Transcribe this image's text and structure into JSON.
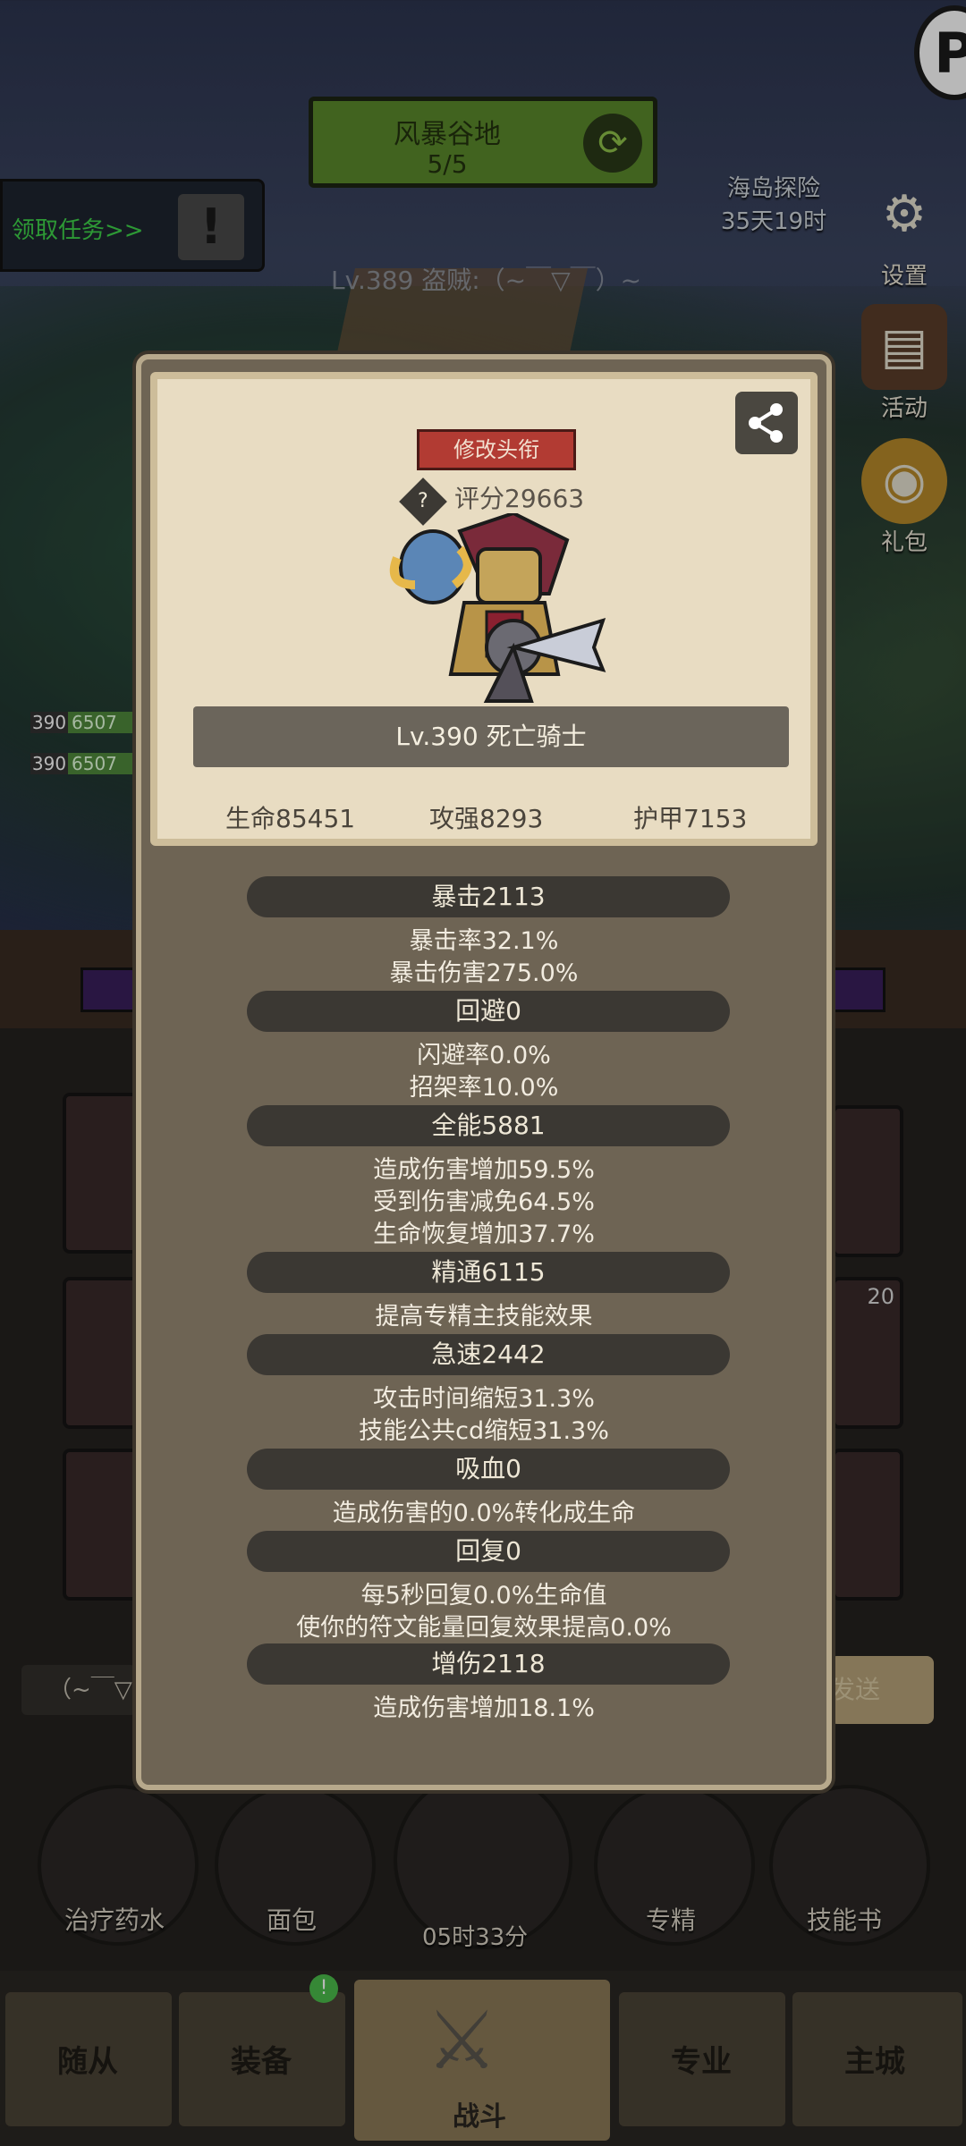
{
  "hud": {
    "zone_title": "风暴谷地",
    "zone_progress": "5/5",
    "task_label": "领取任务>>",
    "player_line": "Lv.389 盗贼:（~￣▽￣）~",
    "island": {
      "label": "海岛探险",
      "timer": "35天19时"
    },
    "settings_label": "设置",
    "activity_label": "活动",
    "gift_label": "礼包",
    "left_hp": [
      {
        "lv": "390",
        "value": "6507"
      },
      {
        "lv": "390",
        "value": "6507"
      }
    ]
  },
  "profile": {
    "rename_button": "修改头衔",
    "score": "评分29663",
    "level_name": "Lv.390 死亡骑士",
    "hp": "生命85451",
    "attack": "攻强8293",
    "armor": "护甲7153"
  },
  "stats": [
    {
      "title": "暴击2113",
      "lines": [
        "暴击率32.1%",
        "暴击伤害275.0%"
      ]
    },
    {
      "title": "回避0",
      "lines": [
        "闪避率0.0%",
        "招架率10.0%"
      ]
    },
    {
      "title": "全能5881",
      "lines": [
        "造成伤害增加59.5%",
        "受到伤害减免64.5%",
        "生命恢复增加37.7%"
      ]
    },
    {
      "title": "精通6115",
      "lines": [
        "提高专精主技能效果"
      ]
    },
    {
      "title": "急速2442",
      "lines": [
        "攻击时间缩短31.3%",
        "技能公共cd缩短31.3%"
      ]
    },
    {
      "title": "吸血0",
      "lines": [
        "造成伤害的0.0%转化成生命"
      ]
    },
    {
      "title": "回复0",
      "lines": [
        "每5秒回复0.0%生命值",
        "使你的符文能量回复效果提高0.0%"
      ]
    },
    {
      "title": "增伤2118",
      "lines": [
        "造成伤害增加18.1%"
      ]
    }
  ],
  "bottom": {
    "send_label": "发送",
    "chat_preview": "（~￣▽",
    "badge_20": "20",
    "actions": [
      "治疗药水",
      "面包",
      "专精",
      "技能书"
    ],
    "timer": "05时33分",
    "nav": [
      "随从",
      "装备",
      "战斗",
      "专业",
      "主城"
    ]
  }
}
